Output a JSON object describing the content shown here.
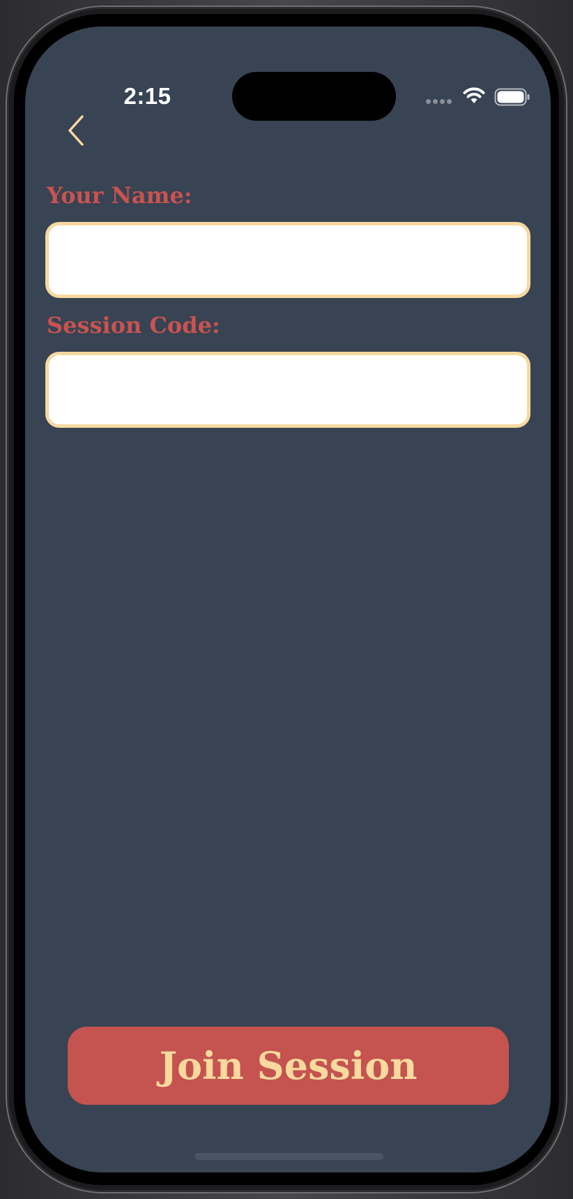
{
  "status_bar": {
    "time": "2:15",
    "icons": [
      "cellular-signal-icon",
      "wifi-icon",
      "battery-icon"
    ]
  },
  "nav": {
    "back_icon": "chevron-left-icon"
  },
  "form": {
    "name_label": "Your Name:",
    "name_value": "",
    "code_label": "Session Code:",
    "code_value": ""
  },
  "actions": {
    "join_label": "Join Session"
  },
  "colors": {
    "background": "#384353",
    "label": "#c9534f",
    "field_border": "#f6d9a0",
    "button": "#c5534f",
    "button_text": "#f8d99e",
    "back_icon": "#f8d99e"
  }
}
